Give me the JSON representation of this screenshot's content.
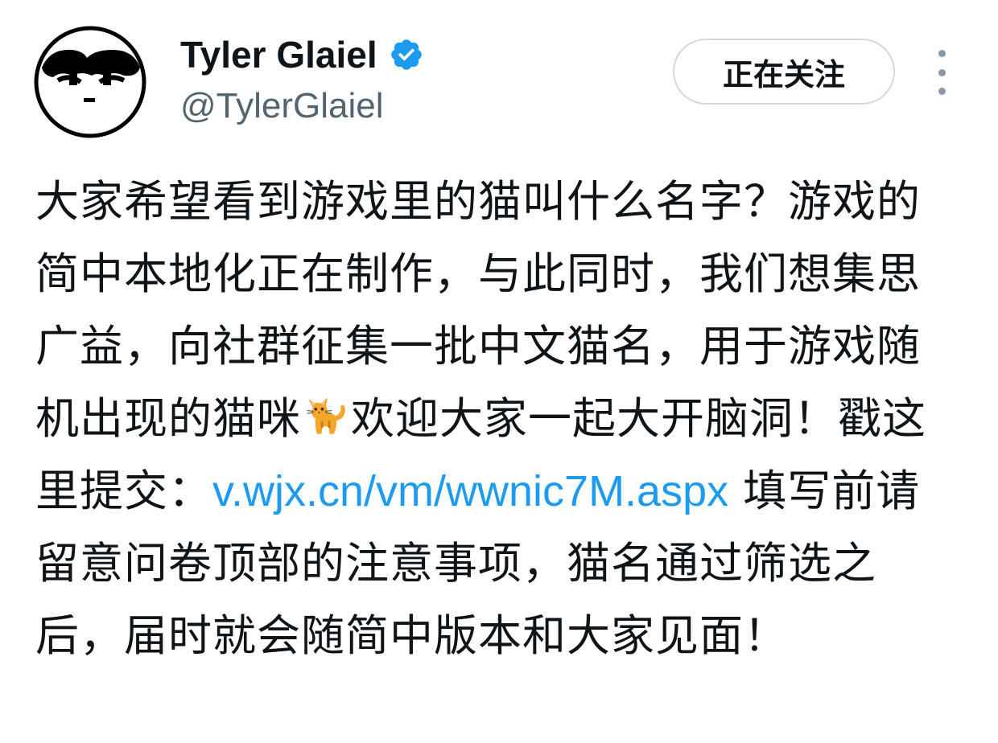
{
  "author": {
    "display_name": "Tyler Glaiel",
    "handle": "@TylerGlaiel",
    "verified": true,
    "verified_color": "#1d9bf0"
  },
  "actions": {
    "follow_label": "正在关注",
    "more_icon": "more-vertical-icon"
  },
  "tweet": {
    "text_part_1": "大家希望看到游戏里的猫叫什么名字？游戏的简中本地化正在制作，与此同时，我们想集思广益，向社群征集一批中文猫名，用于游戏随机出现的猫咪",
    "emoji": "cat-emoji",
    "text_part_2": "欢迎大家一起大开脑洞！戳这里提交：",
    "link": "v.wjx.cn/vm/wwnic7M.aspx",
    "text_part_3": " 填写前请留意问卷顶部的注意事项，猫名通过筛选之后，届时就会随简中版本和大家见面！",
    "link_color": "#1d9bf0"
  }
}
